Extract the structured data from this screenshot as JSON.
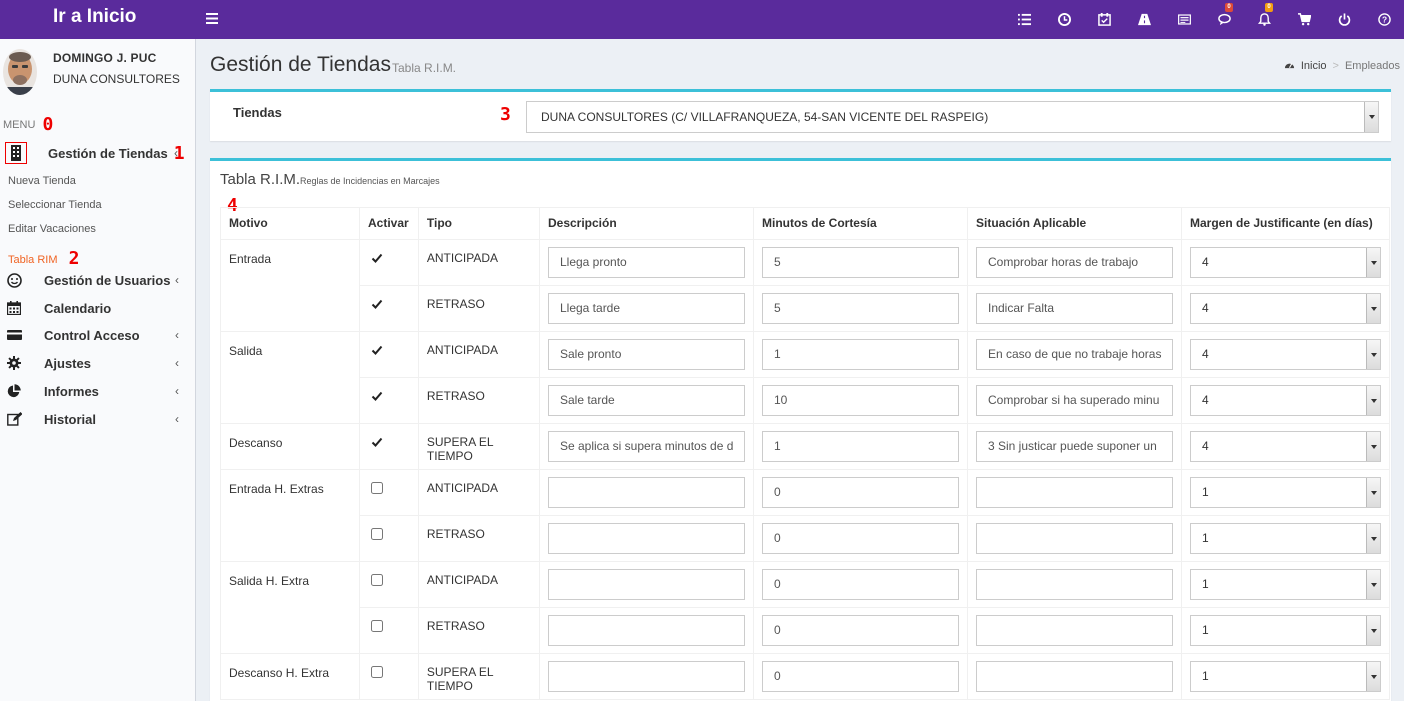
{
  "topbar": {
    "brand": "Ir a Inicio",
    "icons": [
      {
        "name": "list-icon"
      },
      {
        "name": "clock-icon"
      },
      {
        "name": "calendar-check-icon"
      },
      {
        "name": "road-icon"
      },
      {
        "name": "id-card-icon"
      },
      {
        "name": "comments-icon",
        "badge": "0"
      },
      {
        "name": "bell-icon",
        "badge": "0"
      },
      {
        "name": "cart-icon"
      },
      {
        "name": "power-icon"
      },
      {
        "name": "help-icon"
      }
    ]
  },
  "user": {
    "name": "DOMINGO J. PUC",
    "company": "DUNA CONSULTORES"
  },
  "sidebar": {
    "menu_label": "MENU",
    "items": [
      {
        "label": "Gestión de Tiendas",
        "icon": "building-icon"
      },
      {
        "label": "Gestión de Usuarios",
        "icon": "smile-icon"
      },
      {
        "label": "Calendario",
        "icon": "calendar-icon"
      },
      {
        "label": "Control Acceso",
        "icon": "credit-card-icon"
      },
      {
        "label": "Ajustes",
        "icon": "gear-icon"
      },
      {
        "label": "Informes",
        "icon": "pie-chart-icon"
      },
      {
        "label": "Historial",
        "icon": "edit-icon"
      }
    ],
    "subitems": [
      "Nueva Tienda",
      "Seleccionar Tienda",
      "Editar Vacaciones",
      "Tabla RIM"
    ]
  },
  "marks": [
    "0",
    "1",
    "2",
    "3",
    "4"
  ],
  "page": {
    "title": "Gestión de Tiendas",
    "subtitle": "Tabla R.I.M.",
    "breadcrumb": [
      "Inicio",
      "Empleados"
    ]
  },
  "tiendas": {
    "label": "Tiendas",
    "selected": "DUNA CONSULTORES (C/ VILLAFRANQUEZA, 54-SAN VICENTE DEL RASPEIG)"
  },
  "table": {
    "title": "Tabla R.I.M.",
    "subtitle": "Reglas de Incidencias en Marcajes",
    "headers": [
      "Motivo",
      "Activar",
      "Tipo",
      "Descripción",
      "Minutos de Cortesía",
      "Situación Aplicable",
      "Margen de Justificante (en días)"
    ],
    "rows": [
      {
        "motivo": "Entrada",
        "activar": true,
        "tipo": "ANTICIPADA",
        "descripcion": "Llega pronto",
        "minutos": "5",
        "situacion": "Comprobar horas de trabajo",
        "margen": "4"
      },
      {
        "motivo": "",
        "activar": true,
        "tipo": "RETRASO",
        "descripcion": "Llega tarde",
        "minutos": "5",
        "situacion": "Indicar Falta",
        "margen": "4"
      },
      {
        "motivo": "Salida",
        "activar": true,
        "tipo": "ANTICIPADA",
        "descripcion": "Sale pronto",
        "minutos": "1",
        "situacion": "En caso de que no trabaje horas",
        "margen": "4"
      },
      {
        "motivo": "",
        "activar": true,
        "tipo": "RETRASO",
        "descripcion": "Sale tarde",
        "minutos": "10",
        "situacion": "Comprobar si ha superado minu",
        "margen": "4"
      },
      {
        "motivo": "Descanso",
        "activar": true,
        "tipo": "SUPERA EL TIEMPO",
        "descripcion": "Se aplica si supera minutos de d",
        "minutos": "1",
        "situacion": "3 Sin justicar puede suponer un",
        "margen": "4"
      },
      {
        "motivo": "Entrada H. Extras",
        "activar": false,
        "tipo": "ANTICIPADA",
        "descripcion": "",
        "minutos": "0",
        "situacion": "",
        "margen": "1"
      },
      {
        "motivo": "",
        "activar": false,
        "tipo": "RETRASO",
        "descripcion": "",
        "minutos": "0",
        "situacion": "",
        "margen": "1"
      },
      {
        "motivo": "Salida H. Extra",
        "activar": false,
        "tipo": "ANTICIPADA",
        "descripcion": "",
        "minutos": "0",
        "situacion": "",
        "margen": "1"
      },
      {
        "motivo": "",
        "activar": false,
        "tipo": "RETRASO",
        "descripcion": "",
        "minutos": "0",
        "situacion": "",
        "margen": "1"
      },
      {
        "motivo": "Descanso H. Extra",
        "activar": false,
        "tipo": "SUPERA EL TIEMPO",
        "descripcion": "",
        "minutos": "0",
        "situacion": "",
        "margen": "1"
      }
    ]
  },
  "colors": {
    "topbar": "#5a2b9c",
    "accent": "#3cc0d8",
    "active_link": "#f06424",
    "marker": "#ee0000"
  }
}
